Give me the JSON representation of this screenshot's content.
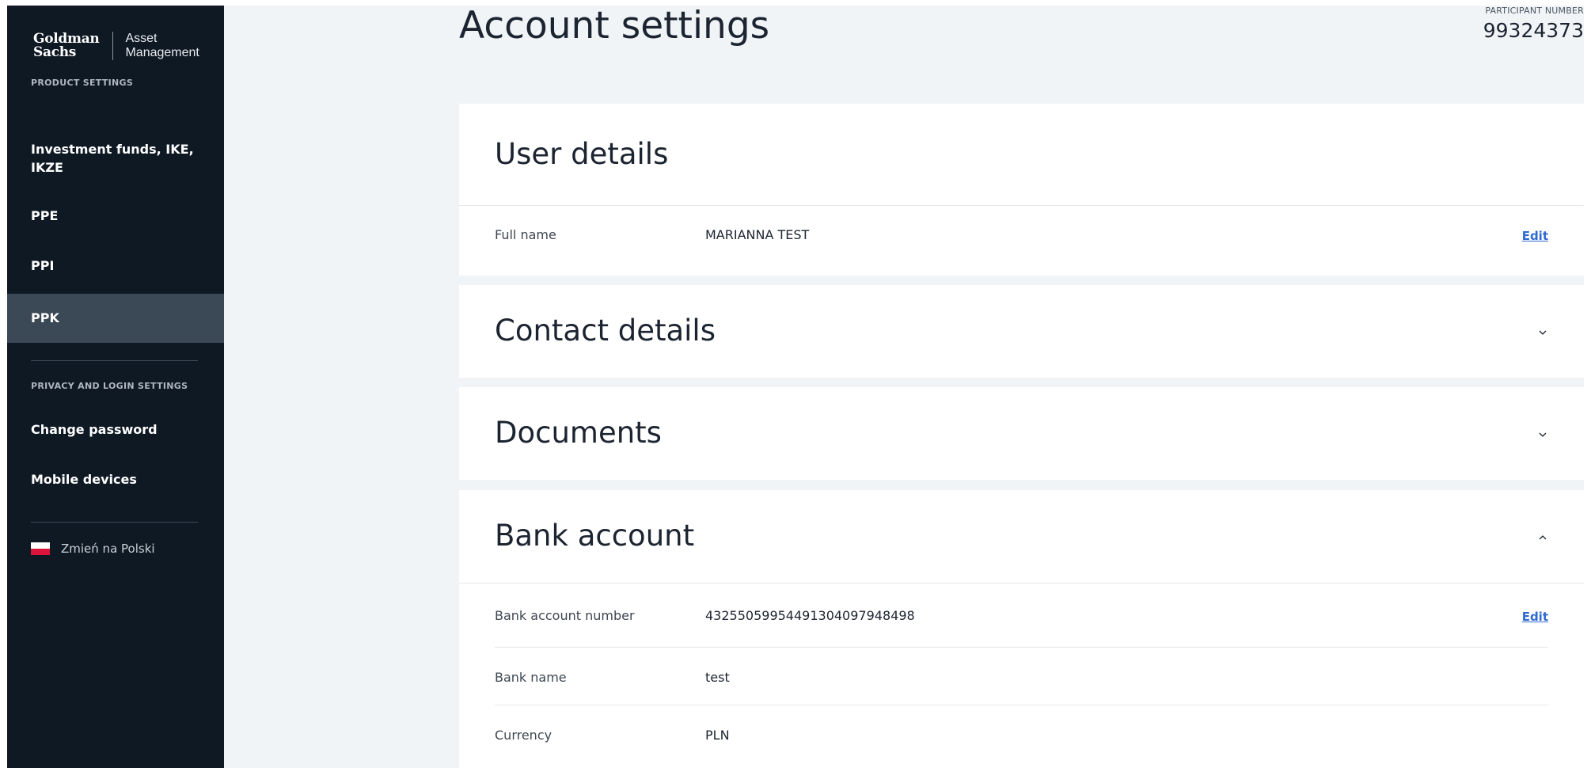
{
  "sidebar": {
    "logo": {
      "brand_line1": "Goldman",
      "brand_line2": "Sachs",
      "sub_line1": "Asset",
      "sub_line2": "Management"
    },
    "product_section_label": "PRODUCT SETTINGS",
    "product_items": [
      {
        "label_line1": "Investment funds, IKE,",
        "label_line2": "IKZE"
      },
      {
        "label": "PPE"
      },
      {
        "label": "PPI"
      },
      {
        "label": "PPK",
        "active": true
      }
    ],
    "privacy_section_label": "PRIVACY AND LOGIN SETTINGS",
    "privacy_items": [
      {
        "label": "Change password"
      },
      {
        "label": "Mobile devices"
      }
    ],
    "language_switch": {
      "label": "Zmień na Polski",
      "icon": "poland-flag-icon"
    }
  },
  "header": {
    "title": "Account settings",
    "participant_label": "PARTICIPANT NUMBER",
    "participant_number": "99324373"
  },
  "sections": {
    "user_details": {
      "title": "User details",
      "rows": [
        {
          "label": "Full name",
          "value": "MARIANNA TEST",
          "action": "Edit"
        }
      ]
    },
    "contact_details": {
      "title": "Contact details",
      "state": "collapsed",
      "icon": "chevron-down-icon"
    },
    "documents": {
      "title": "Documents",
      "state": "collapsed",
      "icon": "chevron-down-icon"
    },
    "bank_account": {
      "title": "Bank account",
      "state": "expanded",
      "icon": "chevron-up-icon",
      "rows": [
        {
          "label": "Bank account number",
          "value": "43255059954491304097948498",
          "action": "Edit"
        },
        {
          "label": "Bank name",
          "value": "test"
        },
        {
          "label": "Currency",
          "value": "PLN"
        }
      ]
    }
  },
  "colors": {
    "sidebar_bg": "#0f1924",
    "sidebar_active": "#3b4856",
    "page_bg": "#f1f4f7",
    "link": "#2f6bd1"
  }
}
